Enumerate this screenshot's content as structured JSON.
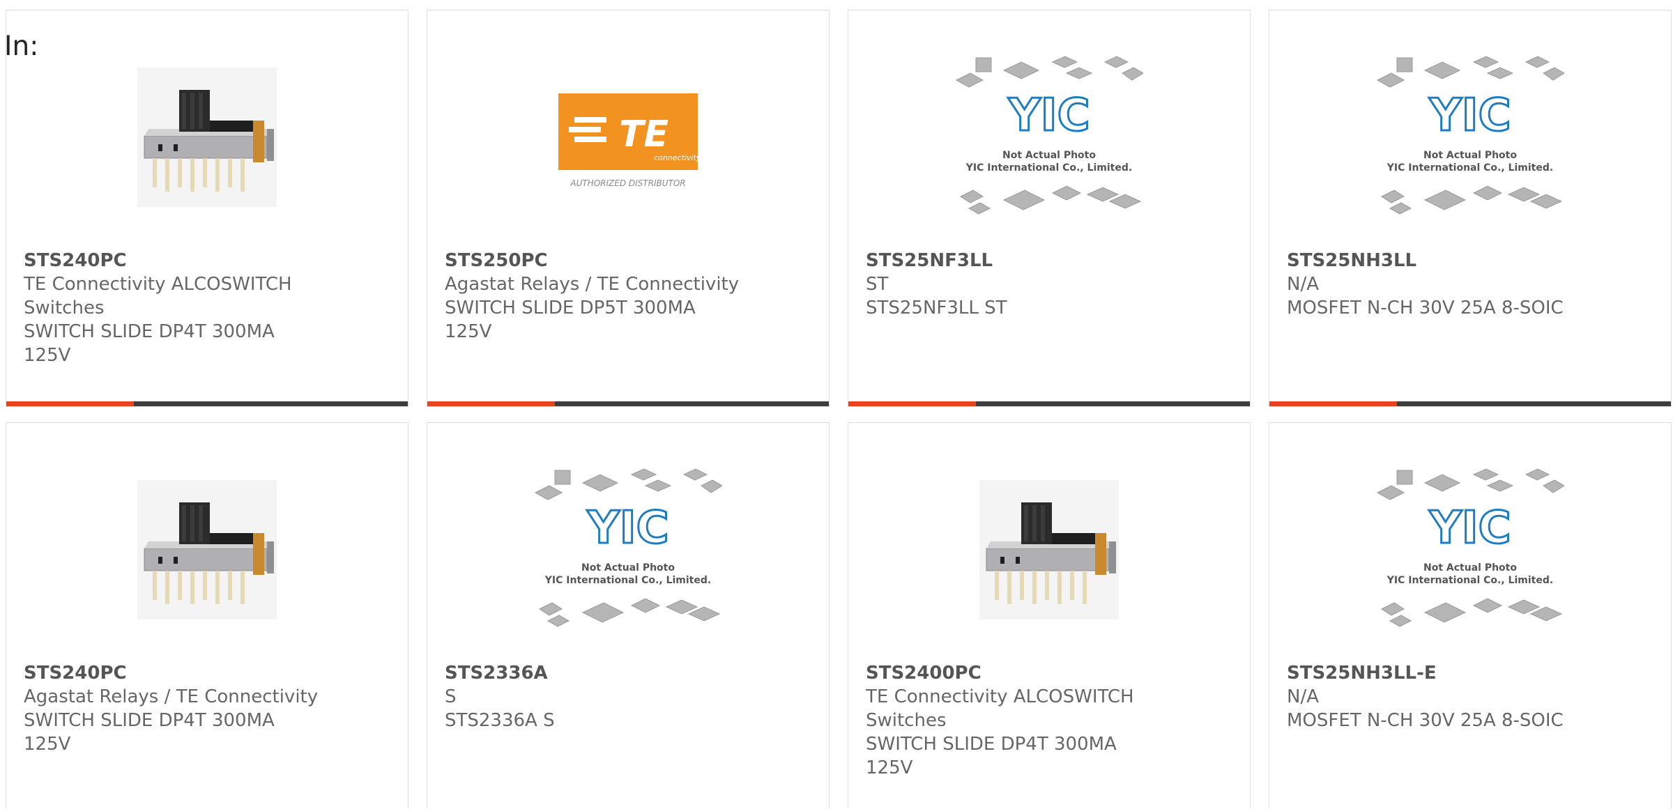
{
  "header": {
    "label": "In:"
  },
  "products": [
    {
      "part": "STS240PC",
      "image": "slide-switch-photo",
      "lines": [
        "TE Connectivity ALCOSWITCH Switches",
        "SWITCH SLIDE DP4T 300MA 125V"
      ]
    },
    {
      "part": "STS250PC",
      "image": "te-connectivity-logo",
      "lines": [
        "Agastat Relays / TE Connectivity",
        "SWITCH SLIDE DP5T 300MA 125V"
      ]
    },
    {
      "part": "STS25NF3LL",
      "image": "yic-placeholder",
      "lines": [
        "ST",
        "STS25NF3LL ST"
      ]
    },
    {
      "part": "STS25NH3LL",
      "image": "yic-placeholder",
      "lines": [
        "N/A",
        "MOSFET N-CH 30V 25A 8-SOIC"
      ]
    },
    {
      "part": "STS240PC",
      "image": "slide-switch-photo",
      "lines": [
        "Agastat Relays / TE Connectivity",
        "SWITCH SLIDE DP4T 300MA 125V"
      ]
    },
    {
      "part": "STS2336A",
      "image": "yic-placeholder",
      "lines": [
        "S",
        "STS2336A S"
      ]
    },
    {
      "part": "STS2400PC",
      "image": "slide-switch-photo",
      "lines": [
        "TE Connectivity ALCOSWITCH Switches",
        "SWITCH SLIDE DP4T 300MA 125V"
      ]
    },
    {
      "part": "STS25NH3LL-E",
      "image": "yic-placeholder",
      "lines": [
        "N/A",
        "MOSFET N-CH 30V 25A 8-SOIC"
      ]
    }
  ],
  "placeholder": {
    "logo_text": "YIC",
    "caption_1": "Not Actual Photo",
    "caption_2": "YIC International Co., Limited."
  },
  "te_logo": {
    "brand": "TE",
    "sub": "connectivity",
    "tagline": "AUTHORIZED DISTRIBUTOR"
  },
  "colors": {
    "accent": "#e8431b",
    "bar": "#3d3d3d",
    "te_orange": "#f29321",
    "yic_blue": "#1e7cc2"
  }
}
